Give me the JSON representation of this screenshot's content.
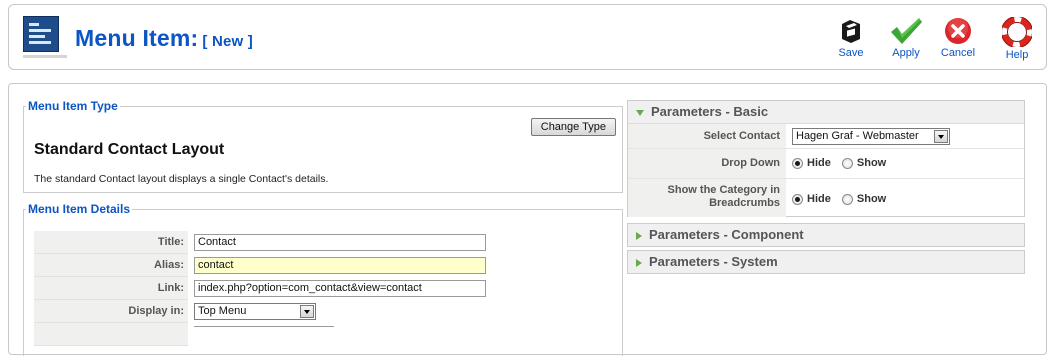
{
  "header": {
    "title": "Menu Item:",
    "subtitle": "[ New ]",
    "buttons": {
      "save": "Save",
      "apply": "Apply",
      "cancel": "Cancel",
      "help": "Help"
    }
  },
  "menu_item_type": {
    "legend": "Menu Item Type",
    "type_title": "Standard Contact Layout",
    "change_type_label": "Change Type",
    "description": "The standard Contact layout displays a single Contact's details."
  },
  "menu_item_details": {
    "legend": "Menu Item Details",
    "title_label": "Title:",
    "title_value": "Contact",
    "alias_label": "Alias:",
    "alias_value": "contact",
    "link_label": "Link:",
    "link_value": "index.php?option=com_contact&view=contact",
    "display_in_label": "Display in:",
    "display_in_value": "Top Menu"
  },
  "parameters_basic": {
    "header": "Parameters - Basic",
    "select_contact_label": "Select Contact",
    "select_contact_value": "Hagen Graf - Webmaster",
    "drop_down_label": "Drop Down",
    "show_category_label_1": "Show the Category in",
    "show_category_label_2": "Breadcrumbs",
    "hide_label": "Hide",
    "show_label": "Show"
  },
  "parameters_component": {
    "header": "Parameters - Component"
  },
  "parameters_system": {
    "header": "Parameters - System"
  },
  "colors": {
    "accent_blue": "#0b55c4",
    "apply_green": "#3aa635",
    "cancel_red": "#d9262a",
    "help_red": "#e0231a",
    "alias_bg": "#ffffcc"
  },
  "icons": [
    "menu-item-page-icon",
    "save-icon",
    "apply-check-icon",
    "cancel-x-icon",
    "help-lifebuoy-icon"
  ]
}
